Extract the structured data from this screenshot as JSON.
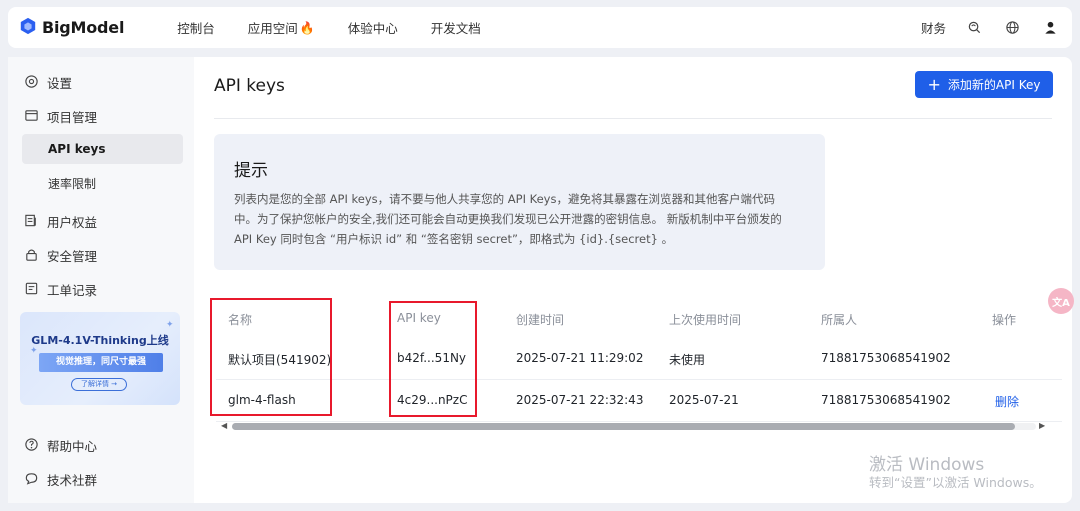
{
  "topbar": {
    "brand": "BigModel",
    "nav": [
      "控制台",
      "应用空间",
      "体验中心",
      "开发文档"
    ],
    "fire_icon": "fire-icon",
    "finance": "财务"
  },
  "sidebar": {
    "items": {
      "settings": "设置",
      "projects": "项目管理",
      "api_keys": "API keys",
      "rate_limit": "速率限制",
      "user_rights": "用户权益",
      "security": "安全管理",
      "tickets": "工单记录",
      "help": "帮助中心",
      "community": "技术社群"
    },
    "promo": {
      "title": "GLM-4.1V-Thinking上线",
      "subtitle": "视觉推理，同尺寸最强",
      "button": "了解详情 →"
    }
  },
  "main": {
    "title": "API keys",
    "add_button": "添加新的API Key",
    "tip": {
      "title": "提示",
      "line1": "列表内是您的全部 API keys，请不要与他人共享您的 API Keys，避免将其暴露在浏览器和其他客户端代码",
      "line2": "中。为了保护您帐户的安全,我们还可能会自动更换我们发现已公开泄露的密钥信息。 新版机制中平台颁发的",
      "line3": "API Key 同时包含 “用户标识 id” 和 “签名密钥 secret”，即格式为 {id}.{secret} 。"
    },
    "table": {
      "headers": [
        "名称",
        "API key",
        "创建时间",
        "上次使用时间",
        "所属人",
        "操作"
      ],
      "rows": [
        {
          "name": "默认项目(541902)",
          "key": "b42f...51Ny",
          "created": "2025-07-21 11:29:02",
          "last_used": "未使用",
          "owner": "71881753068541902",
          "action": ""
        },
        {
          "name": "glm-4-flash",
          "key": "4c29...nPzC",
          "created": "2025-07-21 22:32:43",
          "last_used": "2025-07-21",
          "owner": "71881753068541902",
          "action": "删除"
        }
      ]
    }
  },
  "watermark": {
    "line1": "激活 Windows",
    "line2": "转到“设置”以激活 Windows。"
  },
  "float_button": "文A",
  "colors": {
    "accent": "#1f5fe8",
    "highlight": "#e8192c"
  }
}
